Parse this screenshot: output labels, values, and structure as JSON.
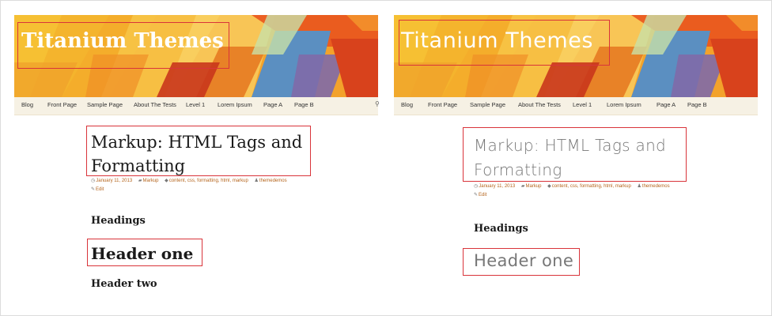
{
  "site": {
    "title": "Titanium Themes"
  },
  "nav": {
    "items": [
      "Blog",
      "Front Page",
      "Sample Page",
      "About The Tests",
      "Level 1",
      "Lorem Ipsum",
      "Page A",
      "Page B"
    ]
  },
  "post": {
    "title": "Markup: HTML Tags and\nFormatting",
    "meta": {
      "date": "January 11, 2013",
      "category": "Markup",
      "tags": "content, css, formatting, html, markup",
      "author": "themedemos",
      "edit": "Edit"
    }
  },
  "content": {
    "section_heading": "Headings",
    "header_one": "Header one",
    "header_two": "Header two"
  },
  "colors": {
    "highlight": "#d9343a",
    "nav_bg": "#f6f1e4",
    "meta_link": "#b5651d"
  }
}
